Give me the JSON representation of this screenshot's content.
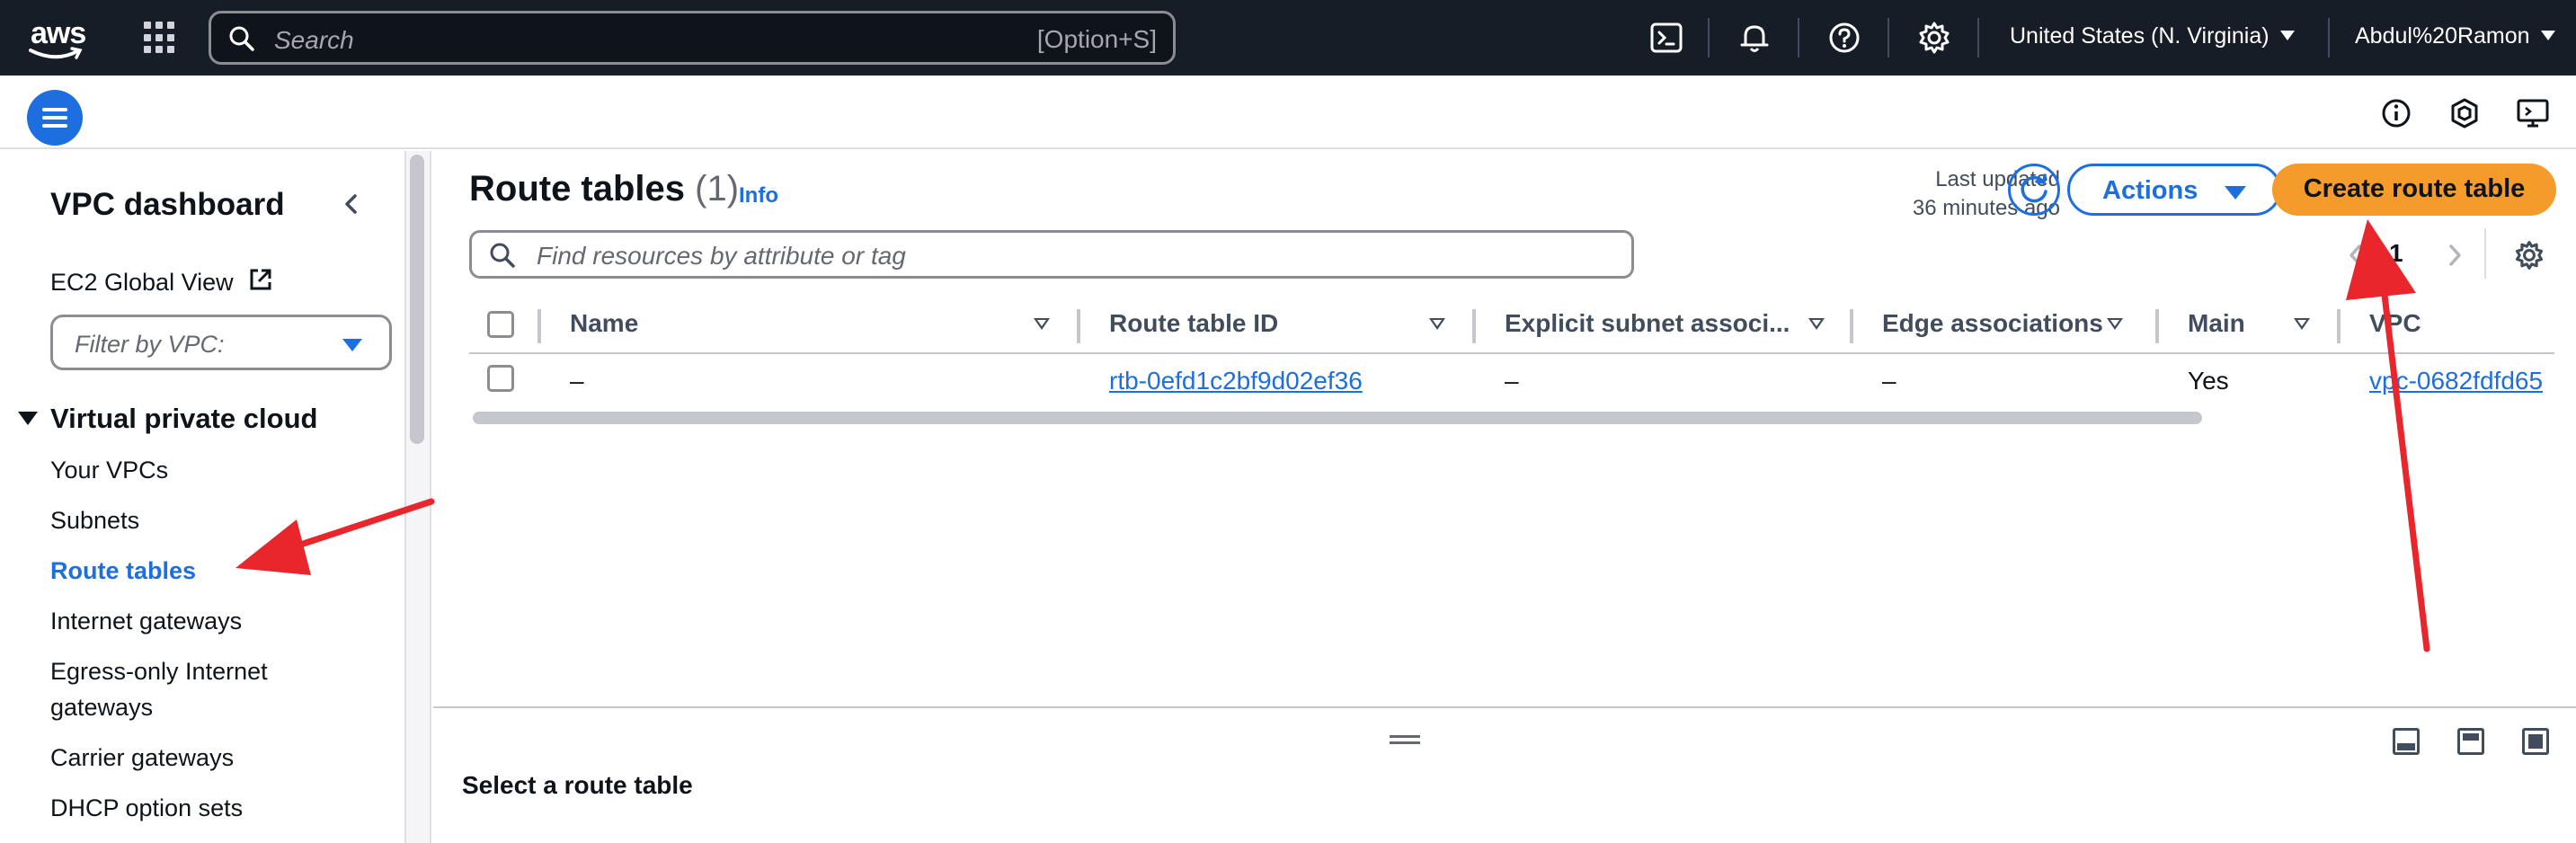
{
  "topnav": {
    "logo_text": "aws",
    "search_placeholder": "Search",
    "search_shortcut": "[Option+S]",
    "region": "United States (N. Virginia)",
    "user": "Abdul%20Ramon",
    "icons": [
      "services-grid-icon",
      "cloudshell-icon",
      "bell-icon",
      "help-icon",
      "settings-icon"
    ]
  },
  "subbar": {
    "icons": [
      "menu-icon",
      "info-circle-icon",
      "cube-icon",
      "feedback-icon"
    ]
  },
  "sidebar": {
    "title": "VPC dashboard",
    "global_view": "EC2 Global View",
    "filter_placeholder": "Filter by VPC:",
    "section": "Virtual private cloud",
    "items": [
      {
        "label": "Your VPCs",
        "active": false
      },
      {
        "label": "Subnets",
        "active": false
      },
      {
        "label": "Route tables",
        "active": true
      },
      {
        "label": "Internet gateways",
        "active": false
      },
      {
        "label": "Egress-only Internet",
        "active": false
      },
      {
        "label": "gateways",
        "active": false
      },
      {
        "label": "Carrier gateways",
        "active": false
      },
      {
        "label": "DHCP option sets",
        "active": false
      }
    ]
  },
  "main": {
    "title": "Route tables",
    "count": "(1)",
    "info": "Info",
    "last_updated_line1": "Last updated",
    "last_updated_line2": "36 minutes ago",
    "actions_label": "Actions",
    "create_label": "Create route table",
    "search_placeholder": "Find resources by attribute or tag",
    "page_number": "1",
    "columns": [
      "Name",
      "Route table ID",
      "Explicit subnet associ...",
      "Edge associations",
      "Main",
      "VPC"
    ],
    "rows": [
      {
        "name": "–",
        "route_table_id": "rtb-0efd1c2bf9d02ef36",
        "explicit_subnet": "–",
        "edge": "–",
        "main": "Yes",
        "vpc": "vpc-0682fdfd65"
      }
    ]
  },
  "split_panel": {
    "title": "Select a route table"
  },
  "colors": {
    "nav_bg": "#161d26",
    "accent": "#1d6fe0",
    "primary_button": "#f49b2b",
    "annotation_arrow": "#e8262c"
  }
}
